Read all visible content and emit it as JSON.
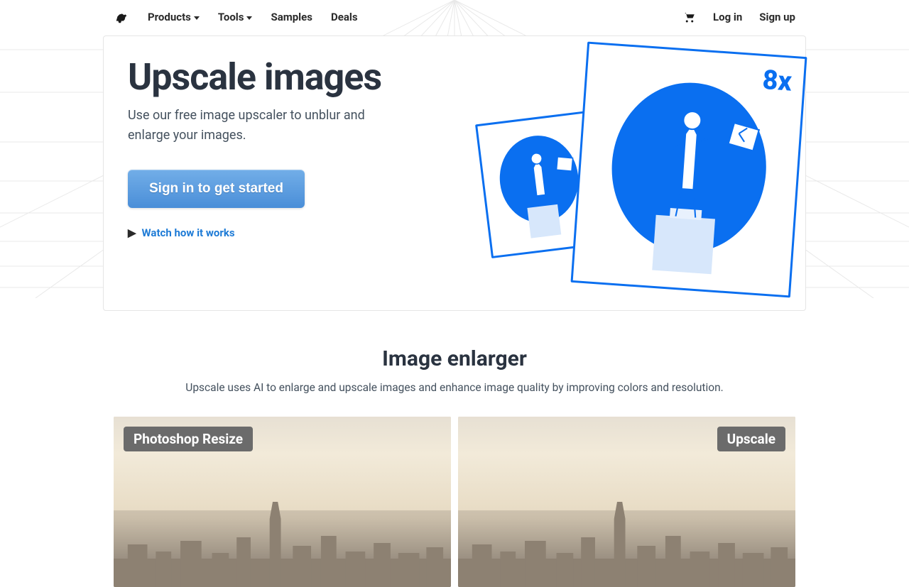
{
  "nav": {
    "products": "Products",
    "tools": "Tools",
    "samples": "Samples",
    "deals": "Deals",
    "login": "Log in",
    "signup": "Sign up"
  },
  "hero": {
    "title": "Upscale images",
    "subtitle": "Use our free image upscaler to unblur and enlarge your images.",
    "cta": "Sign in to get started",
    "watch": "Watch how it works",
    "badge": "8x"
  },
  "section2": {
    "title": "Image enlarger",
    "desc": "Upscale uses AI to enlarge and upscale images and enhance image quality by improving colors and resolution.",
    "label_left": "Photoshop Resize",
    "label_right": "Upscale"
  }
}
